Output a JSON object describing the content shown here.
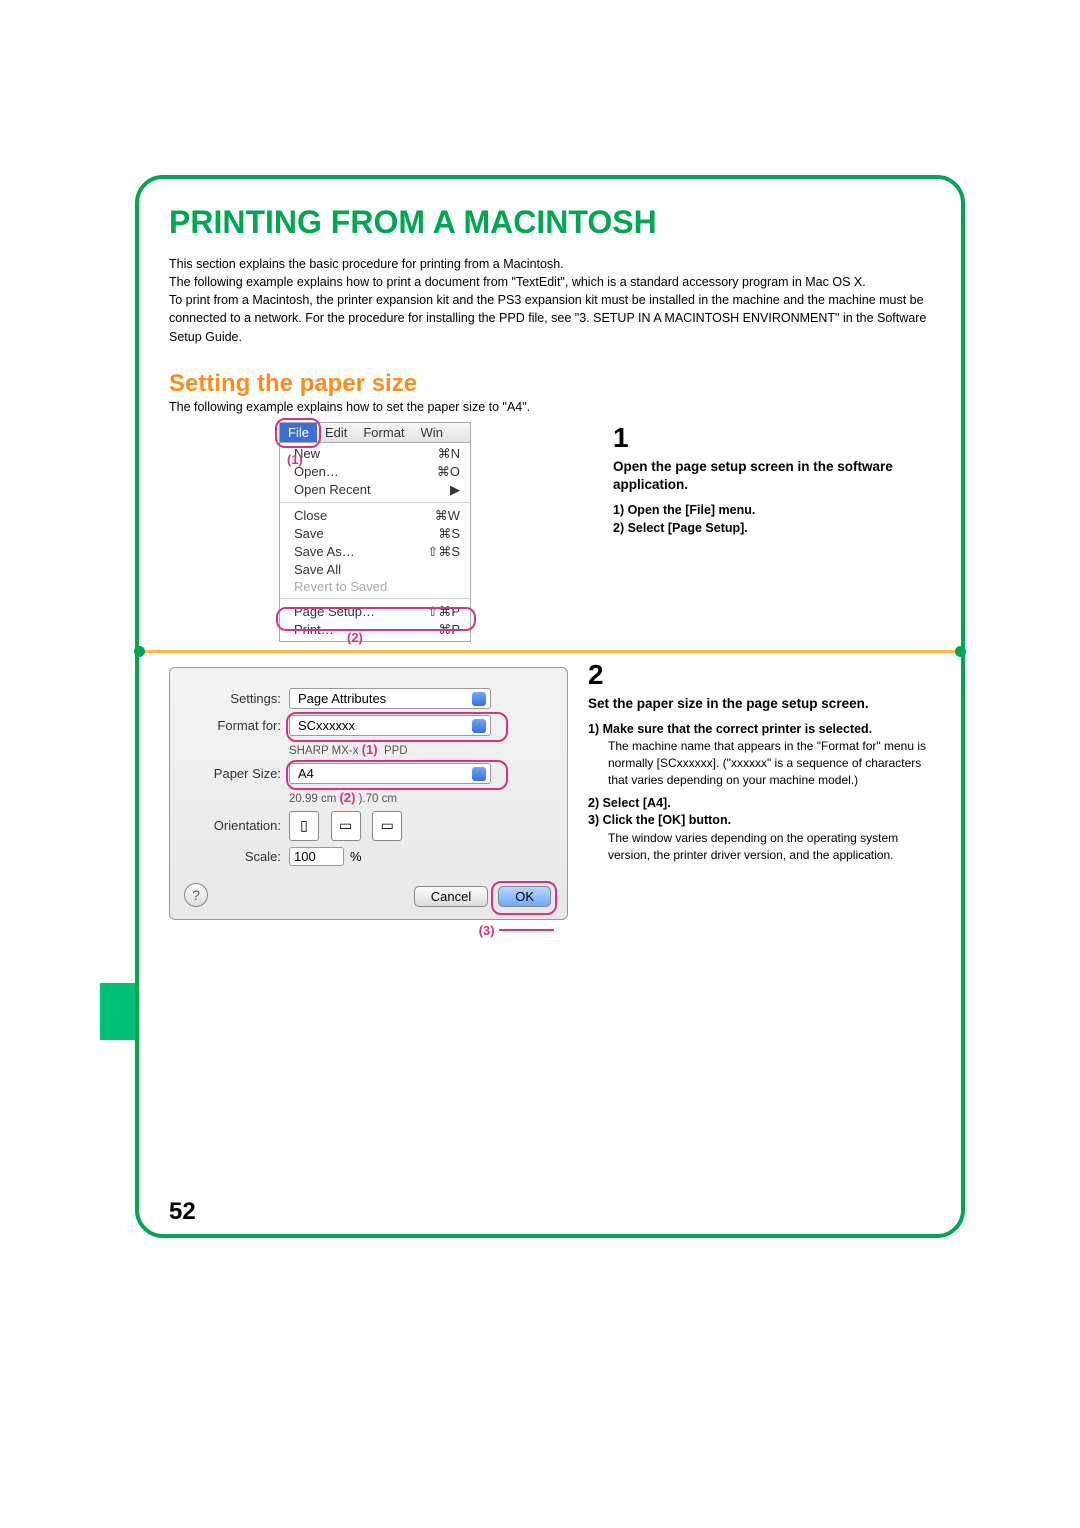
{
  "title": "PRINTING FROM A MACINTOSH",
  "intro": "This section explains the basic procedure for printing from a Macintosh.\nThe following example explains how to print a document from \"TextEdit\", which is a standard accessory program in Mac OS X.\nTo print from a Macintosh, the printer expansion kit and the PS3 expansion kit must be installed in the machine and the machine must be connected to a network. For the procedure for installing the PPD file, see \"3. SETUP IN A MACINTOSH ENVIRONMENT\" in the Software Setup Guide.",
  "section": {
    "heading": "Setting the paper size",
    "sub": "The following example explains how to set the paper size to \"A4\"."
  },
  "menu": {
    "bar": {
      "file": "File",
      "edit": "Edit",
      "format": "Format",
      "win": "Win"
    },
    "items": [
      {
        "label": "New",
        "sc": "⌘N"
      },
      {
        "label": "Open…",
        "sc": "⌘O"
      },
      {
        "label": "Open Recent",
        "sc": "▶"
      },
      {
        "sep": true
      },
      {
        "label": "Close",
        "sc": "⌘W"
      },
      {
        "label": "Save",
        "sc": "⌘S"
      },
      {
        "label": "Save As…",
        "sc": "⇧⌘S"
      },
      {
        "label": "Save All",
        "sc": ""
      },
      {
        "label": "Revert to Saved",
        "sc": "",
        "disabled": true
      },
      {
        "sep": true
      },
      {
        "label": "Page Setup…",
        "sc": "⇧⌘P"
      },
      {
        "label": "Print…",
        "sc": "⌘P"
      }
    ],
    "marker1": "(1)",
    "marker2": "(2)"
  },
  "step1": {
    "num": "1",
    "heading": "Open the page setup screen in the software application.",
    "lines": [
      "1)  Open the [File] menu.",
      "2)  Select [Page Setup]."
    ]
  },
  "pagesetup": {
    "settings": {
      "label": "Settings:",
      "value": "Page Attributes"
    },
    "formatfor": {
      "label": "Format for:",
      "value": "SCxxxxxx",
      "sub": "SHARP MX-x",
      "sub2": "PPD"
    },
    "papersize": {
      "label": "Paper Size:",
      "value": "A4",
      "dims_a": "20.99 cm",
      "dims_b": ").70 cm"
    },
    "orientation": {
      "label": "Orientation:"
    },
    "scale": {
      "label": "Scale:",
      "value": "100",
      "pct": "%"
    },
    "cancel": "Cancel",
    "ok": "OK",
    "help": "?",
    "m1": "(1)",
    "m2": "(2)",
    "m3": "(3)"
  },
  "step2": {
    "num": "2",
    "heading": "Set the paper size in the page setup screen.",
    "item1": "1)  Make sure that the correct printer is selected.",
    "note1": "The machine name that appears in the \"Format for\" menu is normally [SCxxxxxx]. (\"xxxxxx\" is a sequence of characters that varies depending on your machine model.)",
    "item2": "2)  Select [A4].",
    "item3": "3)  Click the [OK] button.",
    "note3": "The window varies depending on the operating system version, the printer driver version, and the application."
  },
  "pagenum": "52"
}
